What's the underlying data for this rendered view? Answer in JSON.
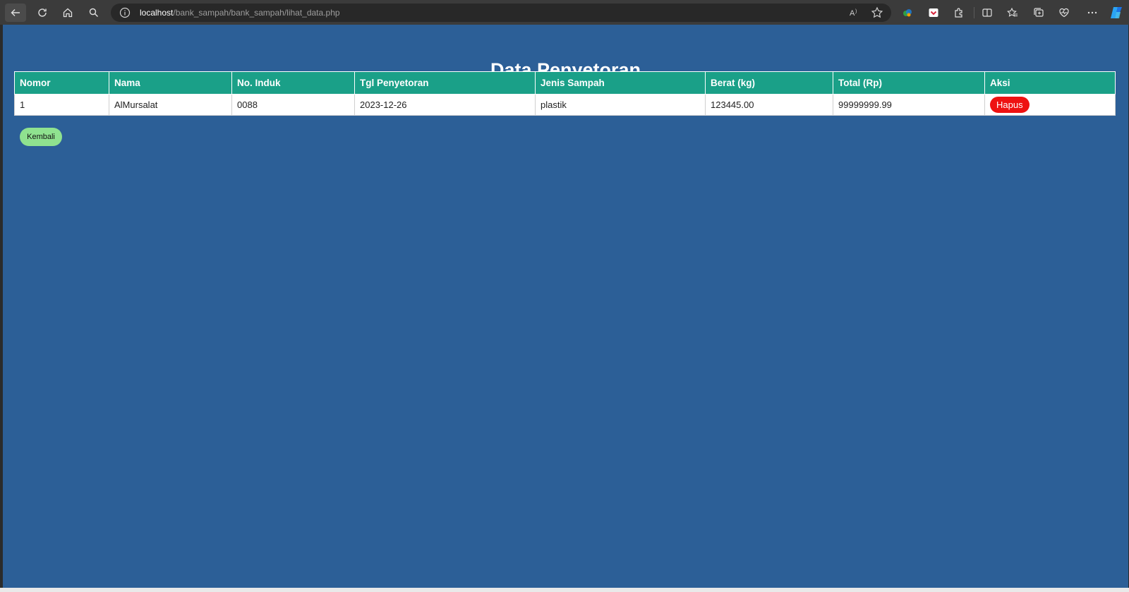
{
  "browser": {
    "url_host": "localhost",
    "url_path": "/bank_sampah/bank_sampah/lihat_data.php",
    "icons": [
      "back-icon",
      "refresh-icon",
      "home-icon",
      "search-icon",
      "info-icon",
      "read-aloud-icon",
      "favorite-star-icon",
      "extension-colorful-icon",
      "pocket-extension-icon",
      "extensions-puzzle-icon",
      "split-screen-icon",
      "favorites-icon",
      "collections-icon",
      "health-heart-icon",
      "more-dots-icon",
      "copilot-icon"
    ]
  },
  "page": {
    "title": "Data Penyetoran",
    "background": "#2c5f97",
    "header_color": "#1aa088"
  },
  "table": {
    "headers": [
      "Nomor",
      "Nama",
      "No. Induk",
      "Tgl Penyetoran",
      "Jenis Sampah",
      "Berat (kg)",
      "Total (Rp)",
      "Aksi"
    ],
    "rows": [
      {
        "nomor": "1",
        "nama": "AlMursalat",
        "no_induk": "0088",
        "tgl": "2023-12-26",
        "jenis": "plastik",
        "berat": "123445.00",
        "total": "99999999.99",
        "aksi": "Hapus"
      }
    ]
  },
  "buttons": {
    "kembali": "Kembali",
    "hapus_color": "#ee1111",
    "kembali_color": "#8fe28f"
  }
}
